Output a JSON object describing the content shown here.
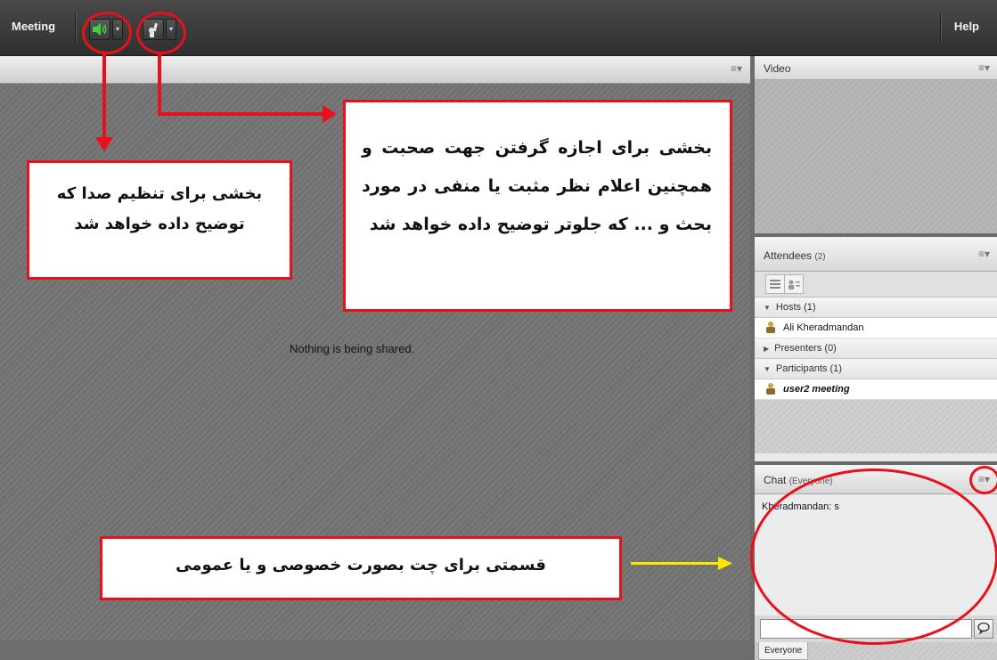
{
  "menubar": {
    "meeting_label": "Meeting",
    "help_label": "Help"
  },
  "share_pod": {
    "message": "Nothing is being shared."
  },
  "video_pod": {
    "title": "Video"
  },
  "attendees_pod": {
    "title": "Attendees",
    "count": "(2)",
    "groups": [
      {
        "label": "Hosts (1)",
        "expanded": true,
        "users": [
          "Ali Kheradmandan"
        ]
      },
      {
        "label": "Presenters (0)",
        "expanded": false,
        "users": []
      },
      {
        "label": "Participants (1)",
        "expanded": true,
        "users": [
          "user2 meeting"
        ]
      }
    ]
  },
  "chat_pod": {
    "title": "Chat",
    "subtitle": "(Everyone)",
    "messages": [
      "Kheradmandan: s"
    ],
    "input_placeholder": "",
    "tab_label": "Everyone"
  },
  "annotations": {
    "audio_note": "بخشی برای تنظیم صدا که توضیح داده خواهد شد",
    "raise_hand_note": "بخشی برای اجازه گرفتن جهت صحبت و همچنین اعلام نظر مثبت یا منفی در مورد بحث و ... که جلوتر توضیح داده خواهد شد",
    "chat_note": "قسمتی برای چت بصورت خصوصی و یا عمومی"
  },
  "colors": {
    "annotation_red": "#e8101a",
    "annotation_yellow": "#ffe800",
    "speaker_green": "#3cd43c"
  }
}
